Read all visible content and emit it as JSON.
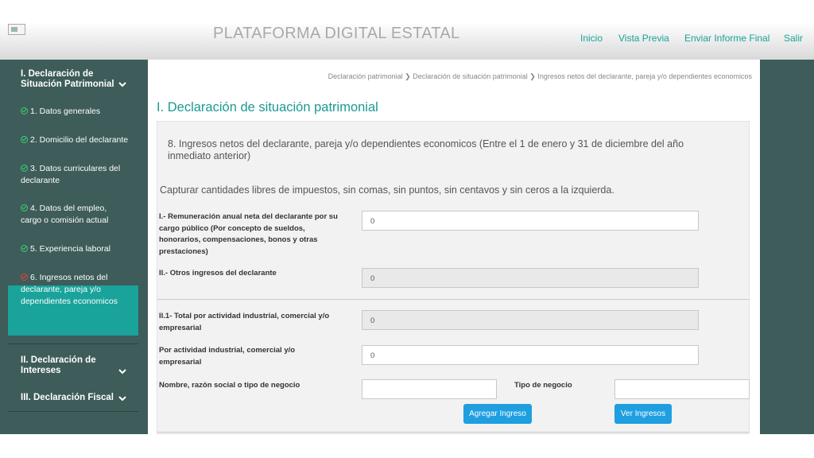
{
  "header": {
    "title": "PLATAFORMA DIGITAL ESTATAL",
    "nav": [
      "Inicio",
      "Vista Previa",
      "Enviar Informe Final",
      "Salir"
    ]
  },
  "sidebar": {
    "section1": "I. Declaración de\nSituación Patrimonial",
    "items": [
      {
        "label": "1. Datos generales",
        "status": "complete"
      },
      {
        "label": "2. Domicilio del declarante",
        "status": "complete"
      },
      {
        "label": "3. Datos curriculares del declarante",
        "status": "complete"
      },
      {
        "label": "4. Datos del empleo, cargo o comisión actual",
        "status": "complete"
      },
      {
        "label": "5. Experiencia laboral",
        "status": "complete"
      },
      {
        "label": "6. Ingresos netos del declarante, pareja y/o dependientes economicos",
        "status": "incomplete"
      }
    ],
    "section2": "II. Declaración de\nIntereses",
    "section3": "III. Declaración Fiscal"
  },
  "breadcrumb": "Declaración patrimonial ❯ Declaración de situación patrimonial ❯ Ingresos netos del declarante, pareja y/o dependientes economicos",
  "page_title": "I. Declaración de situación patrimonial",
  "form": {
    "section_title": "8. Ingresos netos del declarante, pareja y/o dependientes economicos (Entre el 1 de enero y 31 de diciembre del año inmediato anterior)",
    "hint": "Capturar cantidades libres de impuestos, sin comas, sin puntos, sin centavos y sin ceros a la izquierda.",
    "f1_label": "I.- Remuneración anual neta del declarante por su cargo público (Por concepto de sueldos, honorarios, compensaciones, bonos y otras prestaciones)",
    "f1_value": "0",
    "f2_label": "II.- Otros ingresos del declarante",
    "f2_value": "0",
    "f3_label": "II.1- Total por actividad industrial, comercial y/o empresarial",
    "f3_value": "0",
    "f4_label": "Por actividad industrial, comercial y/o empresarial",
    "f4_value": "0",
    "f5_label": "Nombre, razón social o tipo de negocio",
    "f5_value": "",
    "f6_label": "Tipo de negocio",
    "f6_value": "",
    "add_button": "Agregar Ingreso",
    "view_button": "Ver Ingresos"
  },
  "colors": {
    "accent": "#19a39a",
    "sidebar": "#3d5c5a",
    "button": "#1f9fe0",
    "check_ok": "#3fd06e",
    "check_bad": "#e0473a"
  }
}
